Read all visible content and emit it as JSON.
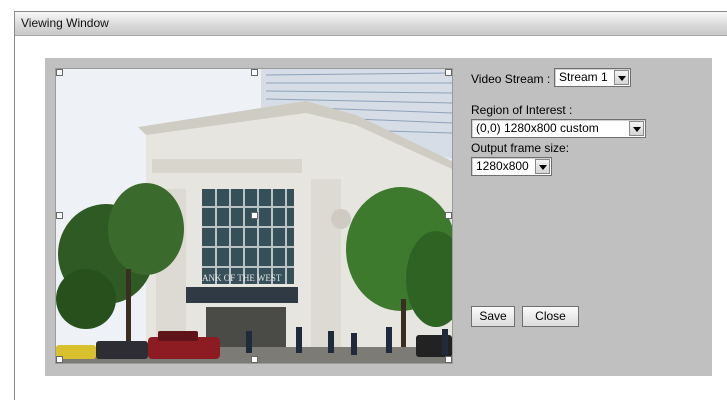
{
  "window": {
    "title": "Viewing Window"
  },
  "video_stream": {
    "label": "Video Stream :",
    "value": "Stream 1"
  },
  "region_of_interest": {
    "label": "Region of Interest :",
    "value": "(0,0) 1280x800 custom"
  },
  "output_frame_size": {
    "label": "Output frame size:",
    "value": "1280x800"
  },
  "buttons": {
    "save": "Save",
    "close": "Close"
  },
  "preview": {
    "sign_text": "BANK OF THE WEST"
  }
}
